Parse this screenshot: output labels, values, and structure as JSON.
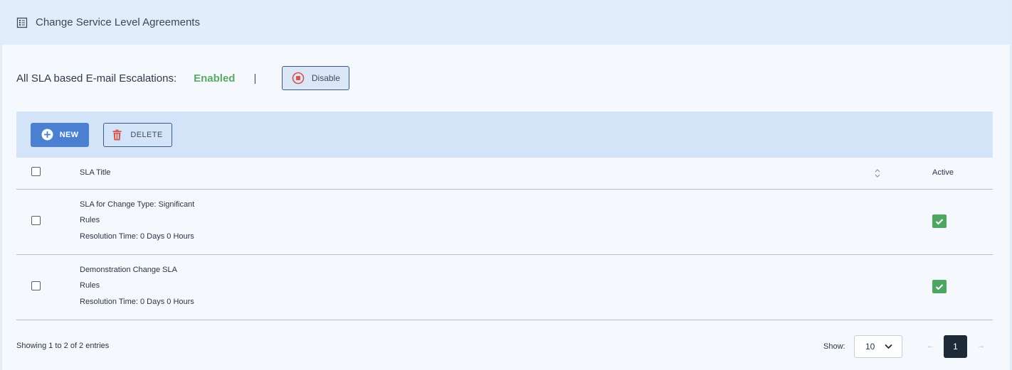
{
  "header": {
    "title": "Change Service Level Agreements",
    "icon": "list-alt-icon"
  },
  "escalation": {
    "label": "All SLA based E-mail Escalations:",
    "status": "Enabled",
    "status_color": "#5aa96a",
    "separator": "|",
    "disable_button": {
      "label": "Disable",
      "icon": "stop-circle-icon"
    }
  },
  "toolbar": {
    "new_button": {
      "label": "NEW",
      "icon": "plus-circle-icon"
    },
    "delete_button": {
      "label": "DELETE",
      "icon": "trash-icon"
    }
  },
  "table": {
    "headers": {
      "title": "SLA Title",
      "active": "Active"
    },
    "rows": [
      {
        "title": "SLA for Change Type: Significant",
        "rules": "Rules",
        "resolution": "Resolution Time: 0 Days 0 Hours",
        "active": true
      },
      {
        "title": "Demonstration Change SLA",
        "rules": "Rules",
        "resolution": "Resolution Time: 0 Days 0 Hours",
        "active": true
      }
    ]
  },
  "footer": {
    "info": "Showing 1 to 2 of 2 entries",
    "show_label": "Show:",
    "page_size": "10",
    "prev": "←",
    "current_page": "1",
    "next": "→"
  },
  "colors": {
    "accent": "#4a7fd1",
    "active_check": "#4fa662",
    "delete_icon": "#d9534f"
  }
}
